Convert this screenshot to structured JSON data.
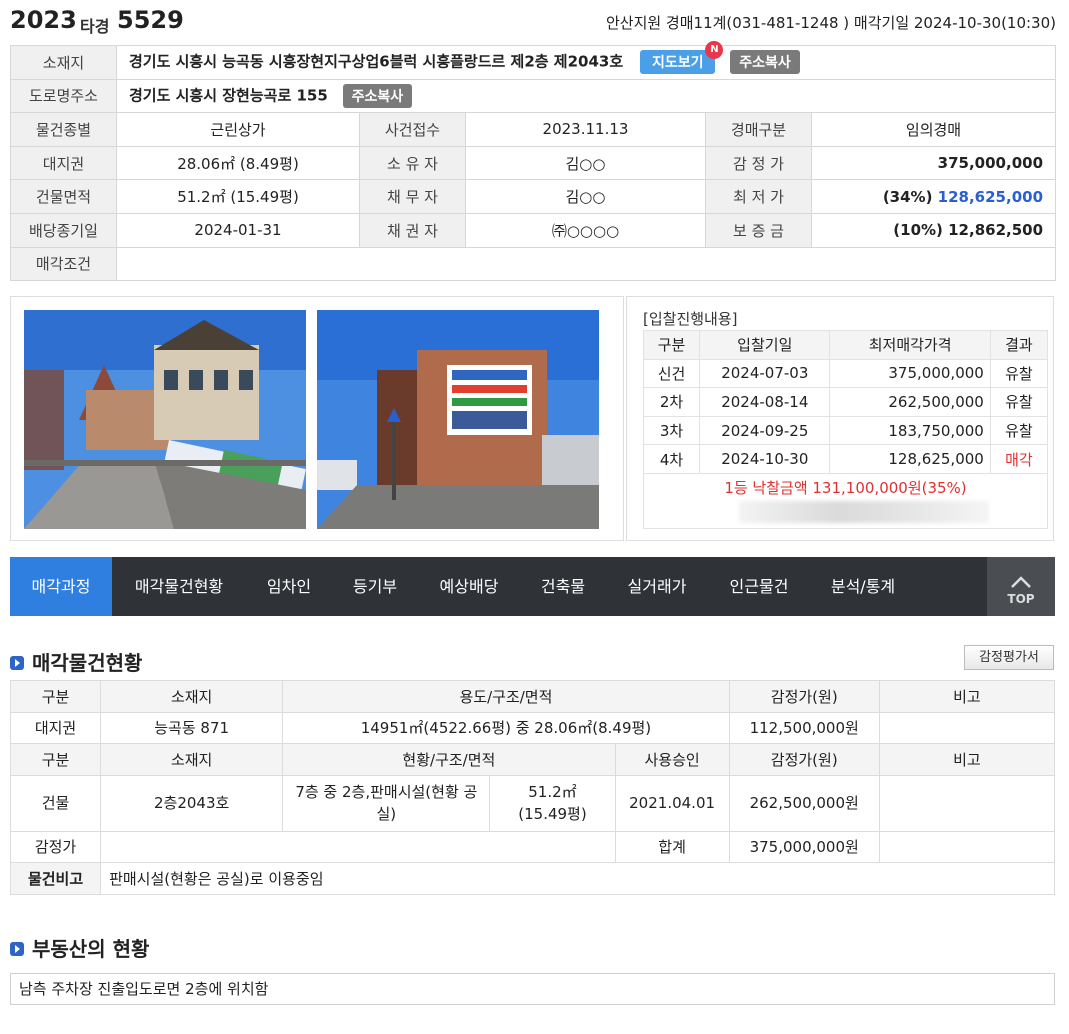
{
  "header": {
    "case_year": "2023",
    "case_type": "타경",
    "case_number": "5529",
    "court_info": "안산지원 경매11계(031-481-1248 ) 매각기일 2024-10-30(10:30)"
  },
  "info": {
    "location_label": "소재지",
    "location": "경기도 시흥시 능곡동 시흥장현지구상업6블럭 시흥플랑드르 제2층 제2043호",
    "map_button": "지도보기",
    "map_badge": "N",
    "copy_button": "주소복사",
    "road_label": "도로명주소",
    "road_address": "경기도 시흥시 장현능곡로 155",
    "rows": [
      {
        "l1": "물건종별",
        "v1": "근린상가",
        "l2": "사건접수",
        "v2": "2023.11.13",
        "l3": "경매구분",
        "v3": "임의경매"
      },
      {
        "l1": "대지권",
        "v1": "28.06㎡ (8.49평)",
        "l2": "소 유 자",
        "v2": "김○○",
        "l3": "감 정 가",
        "v3": "375,000,000"
      },
      {
        "l1": "건물면적",
        "v1": "51.2㎡ (15.49평)",
        "l2": "채 무 자",
        "v2": "김○○",
        "l3": "최 저 가",
        "v3_pct": "(34%)",
        "v3": "128,625,000"
      },
      {
        "l1": "배당종기일",
        "v1": "2024-01-31",
        "l2": "채 권 자",
        "v2": "㈜○○○○",
        "l3": "보 증 금",
        "v3": "(10%) 12,862,500"
      }
    ],
    "condition_label": "매각조건",
    "condition_value": ""
  },
  "bidding": {
    "title": "[입찰진행내용]",
    "headers": [
      "구분",
      "입찰기일",
      "최저매각가격",
      "결과"
    ],
    "rows": [
      {
        "round": "신건",
        "date": "2024-07-03",
        "price": "375,000,000",
        "result": "유찰"
      },
      {
        "round": "2차",
        "date": "2024-08-14",
        "price": "262,500,000",
        "result": "유찰"
      },
      {
        "round": "3차",
        "date": "2024-09-25",
        "price": "183,750,000",
        "result": "유찰"
      },
      {
        "round": "4차",
        "date": "2024-10-30",
        "price": "128,625,000",
        "result": "매각"
      }
    ],
    "winning": "1등 낙찰금액 131,100,000원(35%)"
  },
  "tabs": [
    "매각과정",
    "매각물건현황",
    "임차인",
    "등기부",
    "예상배당",
    "건축물",
    "실거래가",
    "인근물건",
    "분석/통계"
  ],
  "top_label": "TOP",
  "property_status": {
    "title": "매각물건현황",
    "appraisal_button": "감정평가서",
    "land_headers": [
      "구분",
      "소재지",
      "용도/구조/면적",
      "감정가(원)",
      "비고"
    ],
    "land_row": {
      "type": "대지권",
      "location": "능곡동 871",
      "usage": "14951㎡(4522.66평) 중 28.06㎡(8.49평)",
      "value": "112,500,000원",
      "note": ""
    },
    "building_headers": [
      "구분",
      "소재지",
      "현황/구조/면적",
      "사용승인",
      "감정가(원)",
      "비고"
    ],
    "building_row": {
      "type": "건물",
      "location": "2층2043호",
      "structure": "7층 중 2층,판매시설(현황 공실)",
      "area_line1": "51.2㎡",
      "area_line2": "(15.49평)",
      "approval": "2021.04.01",
      "value": "262,500,000원",
      "note": ""
    },
    "appraisal_label": "감정가",
    "total_label": "합계",
    "total_value": "375,000,000원",
    "note_label": "물건비고",
    "note_value": "판매시설(현황은 공실)로 이용중임"
  },
  "real_estate": {
    "title": "부동산의 현황",
    "text": "남측 주차장 진출입도로면 2층에 위치함"
  }
}
